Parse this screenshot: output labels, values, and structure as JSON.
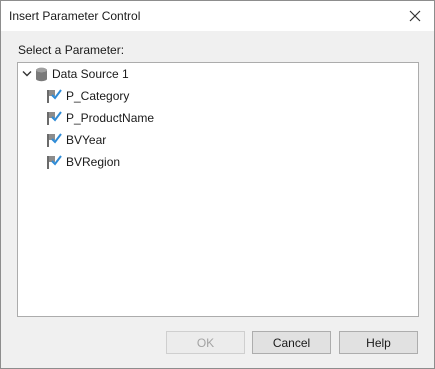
{
  "window": {
    "title": "Insert Parameter Control"
  },
  "prompt": "Select a Parameter:",
  "tree": {
    "root": {
      "label": "Data Source 1",
      "expanded": true,
      "icon": "database-icon"
    },
    "items": [
      {
        "label": "P_Category",
        "icon": "parameter-flag-icon"
      },
      {
        "label": "P_ProductName",
        "icon": "parameter-flag-icon"
      },
      {
        "label": "BVYear",
        "icon": "parameter-flag-icon"
      },
      {
        "label": "BVRegion",
        "icon": "parameter-flag-icon"
      }
    ]
  },
  "buttons": {
    "ok": {
      "label": "OK",
      "enabled": false
    },
    "cancel": {
      "label": "Cancel",
      "enabled": true
    },
    "help": {
      "label": "Help",
      "enabled": true
    }
  },
  "colors": {
    "flag_check": "#2e8bd6",
    "flag_pole": "#6a6a6a",
    "database": "#7a7a7a"
  }
}
